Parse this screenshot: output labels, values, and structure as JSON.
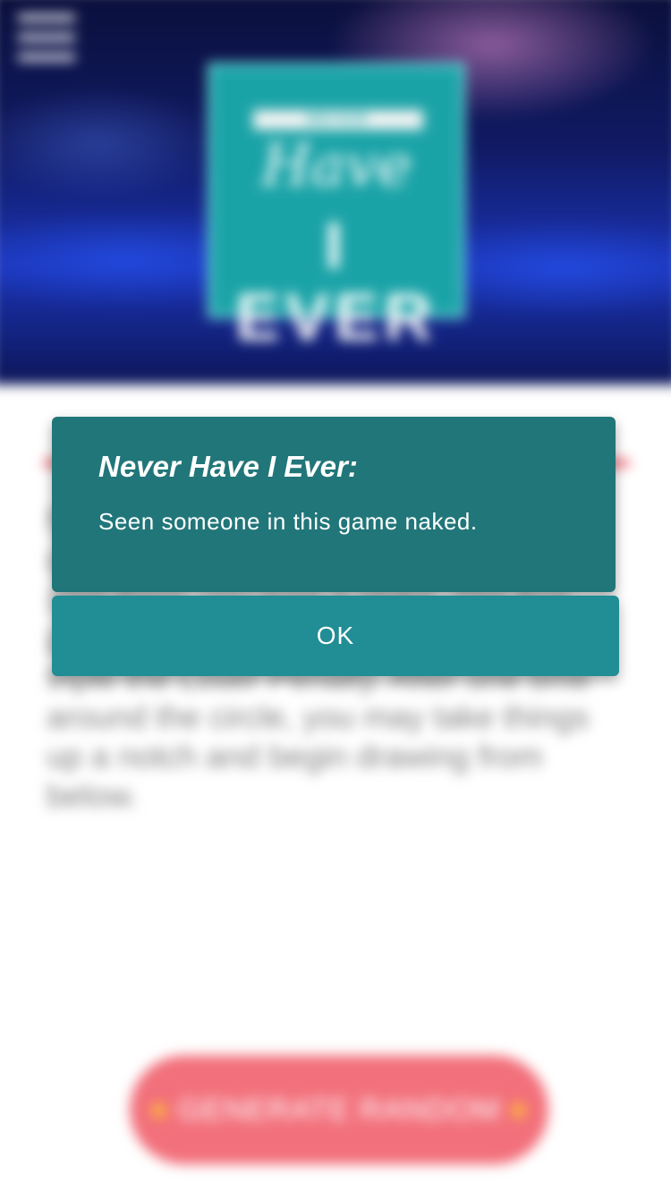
{
  "background": {
    "logo": {
      "band_text": "NEVER",
      "line1": "Have",
      "line2": "I EVER"
    },
    "body_text": "Never have I ever… Go around the circle drawing cards. If you have done said thing, you lose a strike. The first person to lose all 3 strikes is subject to triple the Loser Penalty. After one time around the circle, you may take things up a notch and begin drawing from below.",
    "generate_button": {
      "label": "GENERATE RANDOM",
      "icon": "star-icon"
    },
    "menu_icon": "hamburger-menu-icon"
  },
  "dialog": {
    "title": "Never Have I Ever:",
    "message": "Seen someone in this game naked.",
    "ok_label": "OK"
  },
  "colors": {
    "dialog_bg": "#217679",
    "ok_bg": "#218d94",
    "accent_red": "#ee5565",
    "button_pink": "#f2707b",
    "logo_teal": "#1aa3a7"
  }
}
